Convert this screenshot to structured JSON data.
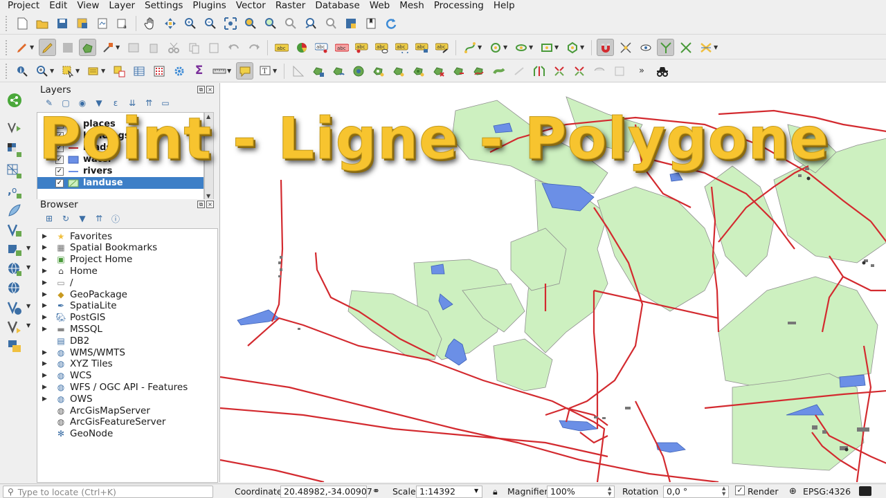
{
  "menubar": {
    "items": [
      "Project",
      "Edit",
      "View",
      "Layer",
      "Settings",
      "Plugins",
      "Vector",
      "Raster",
      "Database",
      "Web",
      "Mesh",
      "Processing",
      "Help"
    ]
  },
  "overlay": {
    "title": "Point - Ligne - Polygone"
  },
  "layers_panel": {
    "title": "Layers",
    "layers": [
      {
        "name": "places",
        "checked": true,
        "symbol": "point"
      },
      {
        "name": "buildings",
        "checked": true,
        "symbol": "polygon-gray"
      },
      {
        "name": "roads",
        "checked": true,
        "symbol": "line-red"
      },
      {
        "name": "water",
        "checked": true,
        "symbol": "polygon-blue"
      },
      {
        "name": "rivers",
        "checked": true,
        "symbol": "line-blue"
      },
      {
        "name": "landuse",
        "checked": true,
        "symbol": "polygon-green",
        "selected": true
      }
    ]
  },
  "browser_panel": {
    "title": "Browser",
    "items": [
      {
        "label": "Favorites",
        "icon": "star-icon",
        "expandable": true
      },
      {
        "label": "Spatial Bookmarks",
        "icon": "bookmark-icon",
        "expandable": true
      },
      {
        "label": "Project Home",
        "icon": "project-home-icon",
        "expandable": true
      },
      {
        "label": "Home",
        "icon": "home-folder-icon",
        "expandable": true
      },
      {
        "label": "/",
        "icon": "folder-icon",
        "expandable": true
      },
      {
        "label": "GeoPackage",
        "icon": "geopackage-icon",
        "expandable": true
      },
      {
        "label": "SpatiaLite",
        "icon": "spatialite-icon",
        "expandable": true
      },
      {
        "label": "PostGIS",
        "icon": "postgis-icon",
        "expandable": true
      },
      {
        "label": "MSSQL",
        "icon": "mssql-icon",
        "expandable": true
      },
      {
        "label": "DB2",
        "icon": "db2-icon",
        "expandable": false
      },
      {
        "label": "WMS/WMTS",
        "icon": "wms-icon",
        "expandable": true
      },
      {
        "label": "XYZ Tiles",
        "icon": "xyz-icon",
        "expandable": true
      },
      {
        "label": "WCS",
        "icon": "wcs-icon",
        "expandable": true
      },
      {
        "label": "WFS / OGC API - Features",
        "icon": "wfs-icon",
        "expandable": true
      },
      {
        "label": "OWS",
        "icon": "ows-icon",
        "expandable": true
      },
      {
        "label": "ArcGisMapServer",
        "icon": "arcgis-map-icon",
        "expandable": false
      },
      {
        "label": "ArcGisFeatureServer",
        "icon": "arcgis-feature-icon",
        "expandable": false
      },
      {
        "label": "GeoNode",
        "icon": "geonode-icon",
        "expandable": false
      }
    ]
  },
  "statusbar": {
    "locator_placeholder": "Type to locate (Ctrl+K)",
    "coordinate_label": "Coordinate",
    "coordinate_value": "20.48982,-34.00907",
    "scale_label": "Scale",
    "scale_value": "1:14392",
    "magnifier_label": "Magnifier",
    "magnifier_value": "100%",
    "rotation_label": "Rotation",
    "rotation_value": "0,0 °",
    "render_label": "Render",
    "crs_label": "EPSG:4326"
  },
  "colors": {
    "landuse": "#cdf0c0",
    "water": "#6b8fe6",
    "roads": "#d32a2f",
    "overlay_text": "#f7c42f",
    "selection": "#3d7fc7"
  }
}
